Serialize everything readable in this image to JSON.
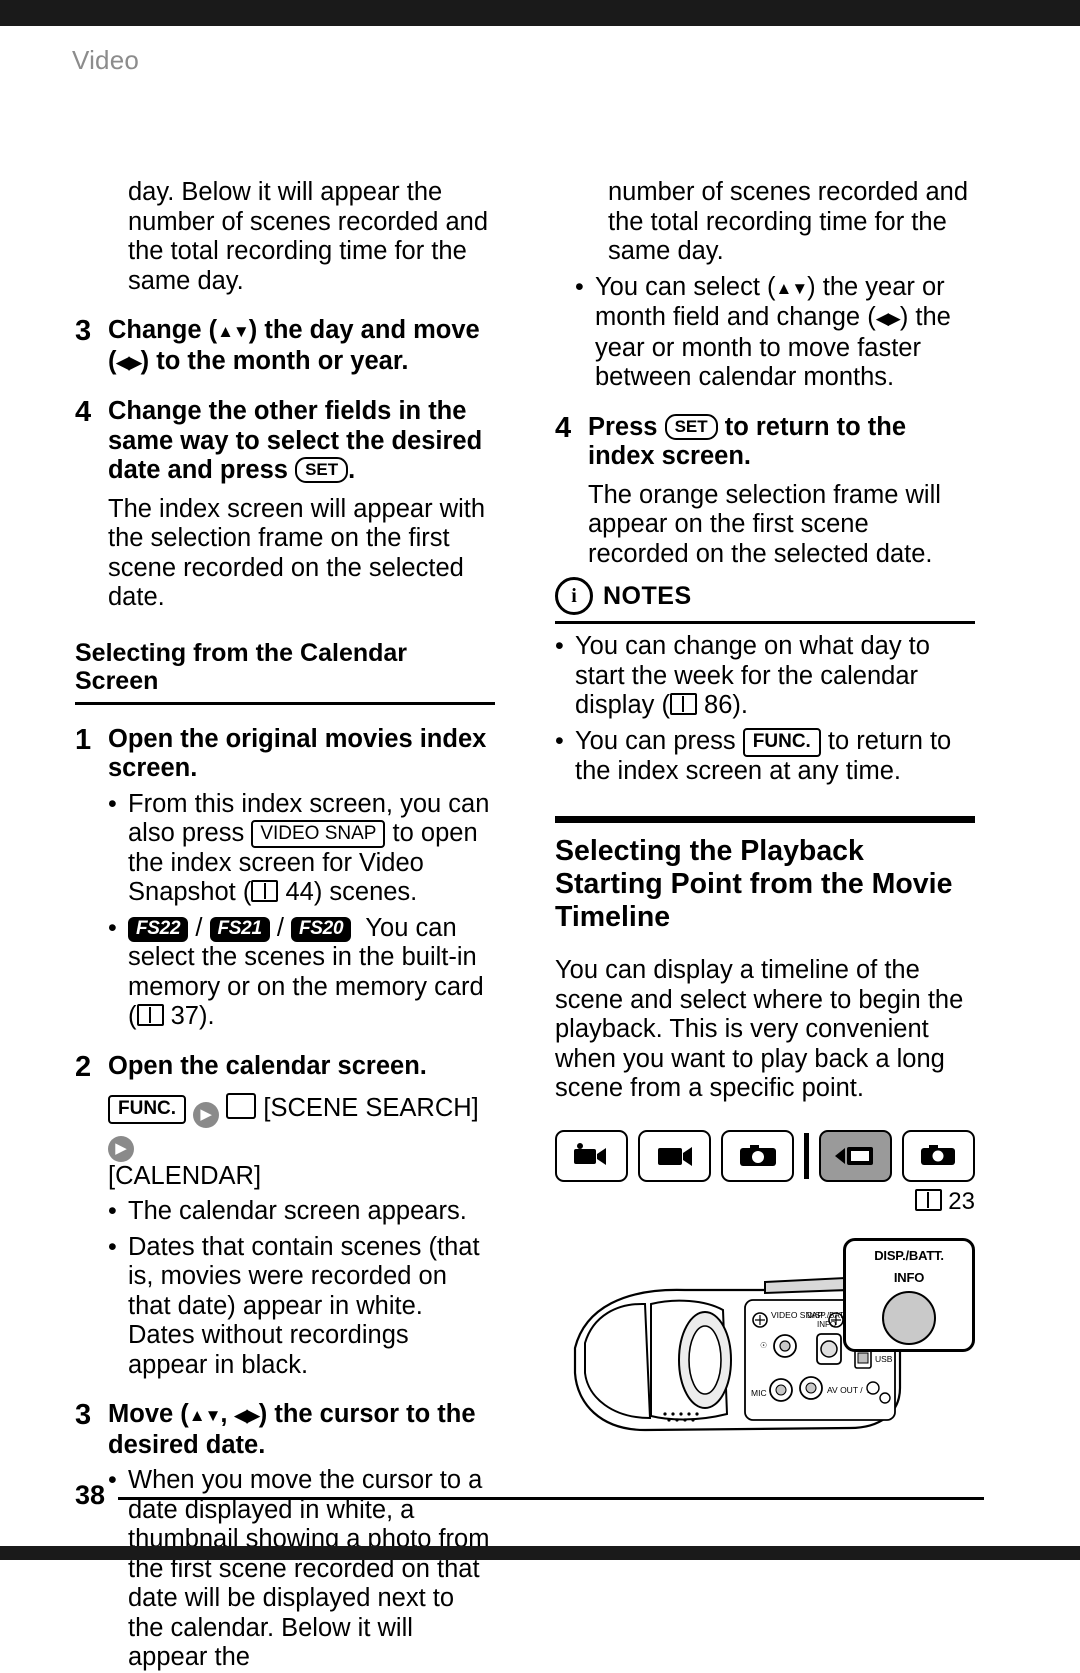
{
  "header": {
    "title": "Video"
  },
  "footer": {
    "page_number": "38"
  },
  "left_column": {
    "continuation_text": "day. Below it will appear the number of scenes recorded and the total recording time for the same day.",
    "step3": {
      "num": "3",
      "text_a": "Change (",
      "updown": "▲▼",
      "text_b": ") the day and move (",
      "leftright": "◀▶",
      "text_c": ") to the month or year."
    },
    "step4": {
      "num": "4",
      "text_a": "Change the other fields in the same way to select the desired date and press ",
      "set_label": "SET",
      "text_b": ".",
      "body": "The index screen will appear with the selection frame on the first scene recorded on the selected date."
    },
    "section_heading": "Selecting from the Calendar Screen",
    "step1": {
      "num": "1",
      "text": "Open the original movies index screen."
    },
    "step1_bullets": [
      {
        "a": "From this index screen, you can also press ",
        "chip": "VIDEO SNAP",
        "b": " to open the index screen for Video Snapshot (",
        "page": "44",
        "c": ") scenes."
      }
    ],
    "model_bullet": {
      "m1": "FS22",
      "sep1": "/",
      "m2": "FS21",
      "sep2": "/",
      "m3": "FS20",
      "text": "You can select the scenes in the built-in memory or on the memory card (",
      "page": "37",
      "tail": ")."
    },
    "step2": {
      "num": "2",
      "text": "Open the calendar screen."
    },
    "menu_path": {
      "func": "FUNC.",
      "arrow1": "▶",
      "scene_icon": "camera-scene-icon",
      "label1": "[",
      "scene_search": "SCENE SEARCH",
      "label1b": "]",
      "arrow2": "▶",
      "calendar": "[CALENDAR]"
    },
    "step2_bullets": [
      "The calendar screen appears.",
      "Dates that contain scenes (that is, movies were recorded on that date) appear in white. Dates without recordings appear in black."
    ],
    "step3b": {
      "num": "3",
      "text_a": "Move (",
      "updown": "▲▼",
      "text_b": ", ",
      "leftright": "◀▶",
      "text_c": ") the cursor to the desired date."
    },
    "step3b_bullets": [
      "When you move the cursor to a date displayed in white, a thumbnail showing a photo from the first scene recorded on that date will be displayed next to the calendar. Below it will appear the"
    ]
  },
  "right_column": {
    "continuation_text": "number of scenes recorded and the total recording time for the same day.",
    "bullet1": {
      "a": "You can select (",
      "updown": "▲▼",
      "b": ") the year or month field and change (",
      "leftright": "◀▶",
      "c": ") the year or month to move faster between calendar months."
    },
    "step4": {
      "num": "4",
      "text_a": "Press ",
      "set_label": "SET",
      "text_b": " to return to the index screen.",
      "body": "The orange selection frame will appear on the first scene recorded on the selected date."
    },
    "notes": {
      "label": "NOTES",
      "items": [
        {
          "a": "You can change on what day to start the week for the calendar display (",
          "page": "86",
          "b": ")."
        },
        {
          "a": "You can press ",
          "chip": "FUNC.",
          "b": " to return to the index screen at any time."
        }
      ]
    },
    "section_heading": "Selecting the Playback Starting Point from the Movie Timeline",
    "body_text": "You can display a timeline of the scene and select where to begin the playback. This is very convenient when you want to play back a long scene from a specific point.",
    "mode_bar": {
      "buttons": [
        {
          "name": "camera-movie-record-icon",
          "selected": false
        },
        {
          "name": "movie-playback-icon",
          "selected": false
        },
        {
          "name": "photo-camera-icon",
          "selected": false
        },
        {
          "name": "photo-playback-icon",
          "selected": true
        },
        {
          "name": "photo-view-icon",
          "selected": false
        }
      ],
      "page_ref": "23"
    },
    "camera_callout": {
      "line1": "DISP./BATT.",
      "line2": "INFO"
    },
    "camera_labels": {
      "video_snap": "VIDEO SNAP",
      "disp_batt": "DISP./BATT.",
      "info": "INFO",
      "usb": "USB",
      "av_out": "AV OUT /",
      "mic": "MIC"
    }
  }
}
